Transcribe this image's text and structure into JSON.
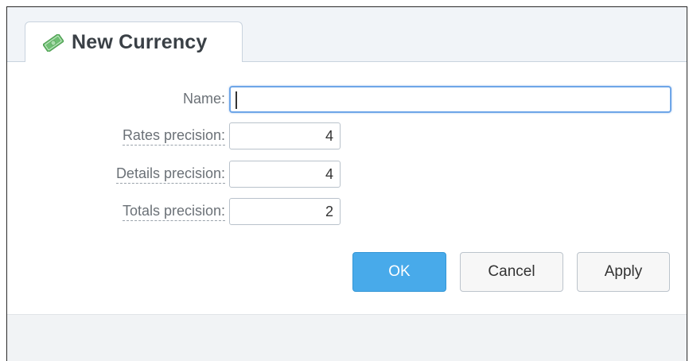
{
  "window": {
    "title": "New Currency",
    "icon": "money-icon"
  },
  "form": {
    "name": {
      "label": "Name:",
      "value": ""
    },
    "rates_precision": {
      "label": "Rates precision:",
      "value": "4"
    },
    "details_precision": {
      "label": "Details precision:",
      "value": "4"
    },
    "totals_precision": {
      "label": "Totals precision:",
      "value": "2"
    }
  },
  "buttons": {
    "ok": "OK",
    "cancel": "Cancel",
    "apply": "Apply"
  },
  "colors": {
    "accent": "#48aaea",
    "focus_border": "#6ea6e8",
    "icon_green": "#6fbf73"
  }
}
